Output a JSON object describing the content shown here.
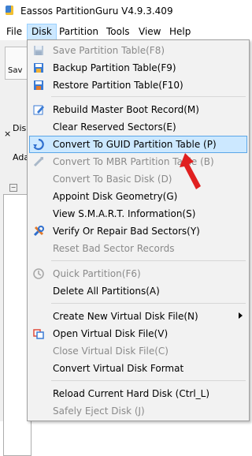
{
  "window": {
    "title": "Eassos PartitionGuru V4.9.3.409"
  },
  "menubar": [
    {
      "label": "File"
    },
    {
      "label": "Disk",
      "active": true
    },
    {
      "label": "Partition"
    },
    {
      "label": "Tools"
    },
    {
      "label": "View"
    },
    {
      "label": "Help"
    }
  ],
  "background": {
    "toolbar_label": "Sav",
    "close_glyph": "×",
    "side_label_1": "Disk",
    "side_label_2": "Ada",
    "tree_toggle": "−"
  },
  "menu": {
    "items": [
      {
        "label": "Save Partition Table(F8)",
        "enabled": false,
        "icon": "save-icon"
      },
      {
        "label": "Backup Partition Table(F9)",
        "enabled": true,
        "icon": "backup-icon"
      },
      {
        "label": "Restore Partition Table(F10)",
        "enabled": true,
        "icon": "restore-icon"
      },
      {
        "label": "Rebuild Master Boot Record(M)",
        "enabled": true,
        "icon": "rebuild-mbr-icon"
      },
      {
        "label": "Clear Reserved Sectors(E)",
        "enabled": true,
        "icon": ""
      },
      {
        "label": "Convert To GUID Partition Table (P)",
        "enabled": true,
        "icon": "convert-gpt-icon",
        "highlighted": true
      },
      {
        "label": "Convert To MBR Partition Table (B)",
        "enabled": false,
        "icon": "convert-mbr-icon"
      },
      {
        "label": "Convert To Basic Disk (D)",
        "enabled": false,
        "icon": ""
      },
      {
        "label": "Appoint Disk Geometry(G)",
        "enabled": true,
        "icon": ""
      },
      {
        "label": "View S.M.A.R.T. Information(S)",
        "enabled": true,
        "icon": ""
      },
      {
        "label": "Verify Or Repair Bad Sectors(Y)",
        "enabled": true,
        "icon": "tools-icon"
      },
      {
        "label": "Reset Bad Sector Records",
        "enabled": false,
        "icon": ""
      },
      {
        "label": "Quick Partition(F6)",
        "enabled": false,
        "icon": "quick-partition-icon"
      },
      {
        "label": "Delete All Partitions(A)",
        "enabled": true,
        "icon": ""
      },
      {
        "label": "Create New Virtual Disk File(N)",
        "enabled": true,
        "icon": "",
        "submenu": true
      },
      {
        "label": "Open Virtual Disk File(V)",
        "enabled": true,
        "icon": "open-vdisk-icon"
      },
      {
        "label": "Close Virtual Disk File(C)",
        "enabled": false,
        "icon": ""
      },
      {
        "label": "Convert Virtual Disk Format",
        "enabled": true,
        "icon": ""
      },
      {
        "label": "Reload Current Hard Disk (Ctrl_L)",
        "enabled": true,
        "icon": ""
      },
      {
        "label": "Safely Eject Disk (J)",
        "enabled": false,
        "icon": ""
      }
    ]
  },
  "colors": {
    "highlight": "#cce8ff",
    "highlight_border": "#5aa6e8",
    "disabled_text": "#8a8a8a",
    "annotation_arrow": "#e02020"
  }
}
